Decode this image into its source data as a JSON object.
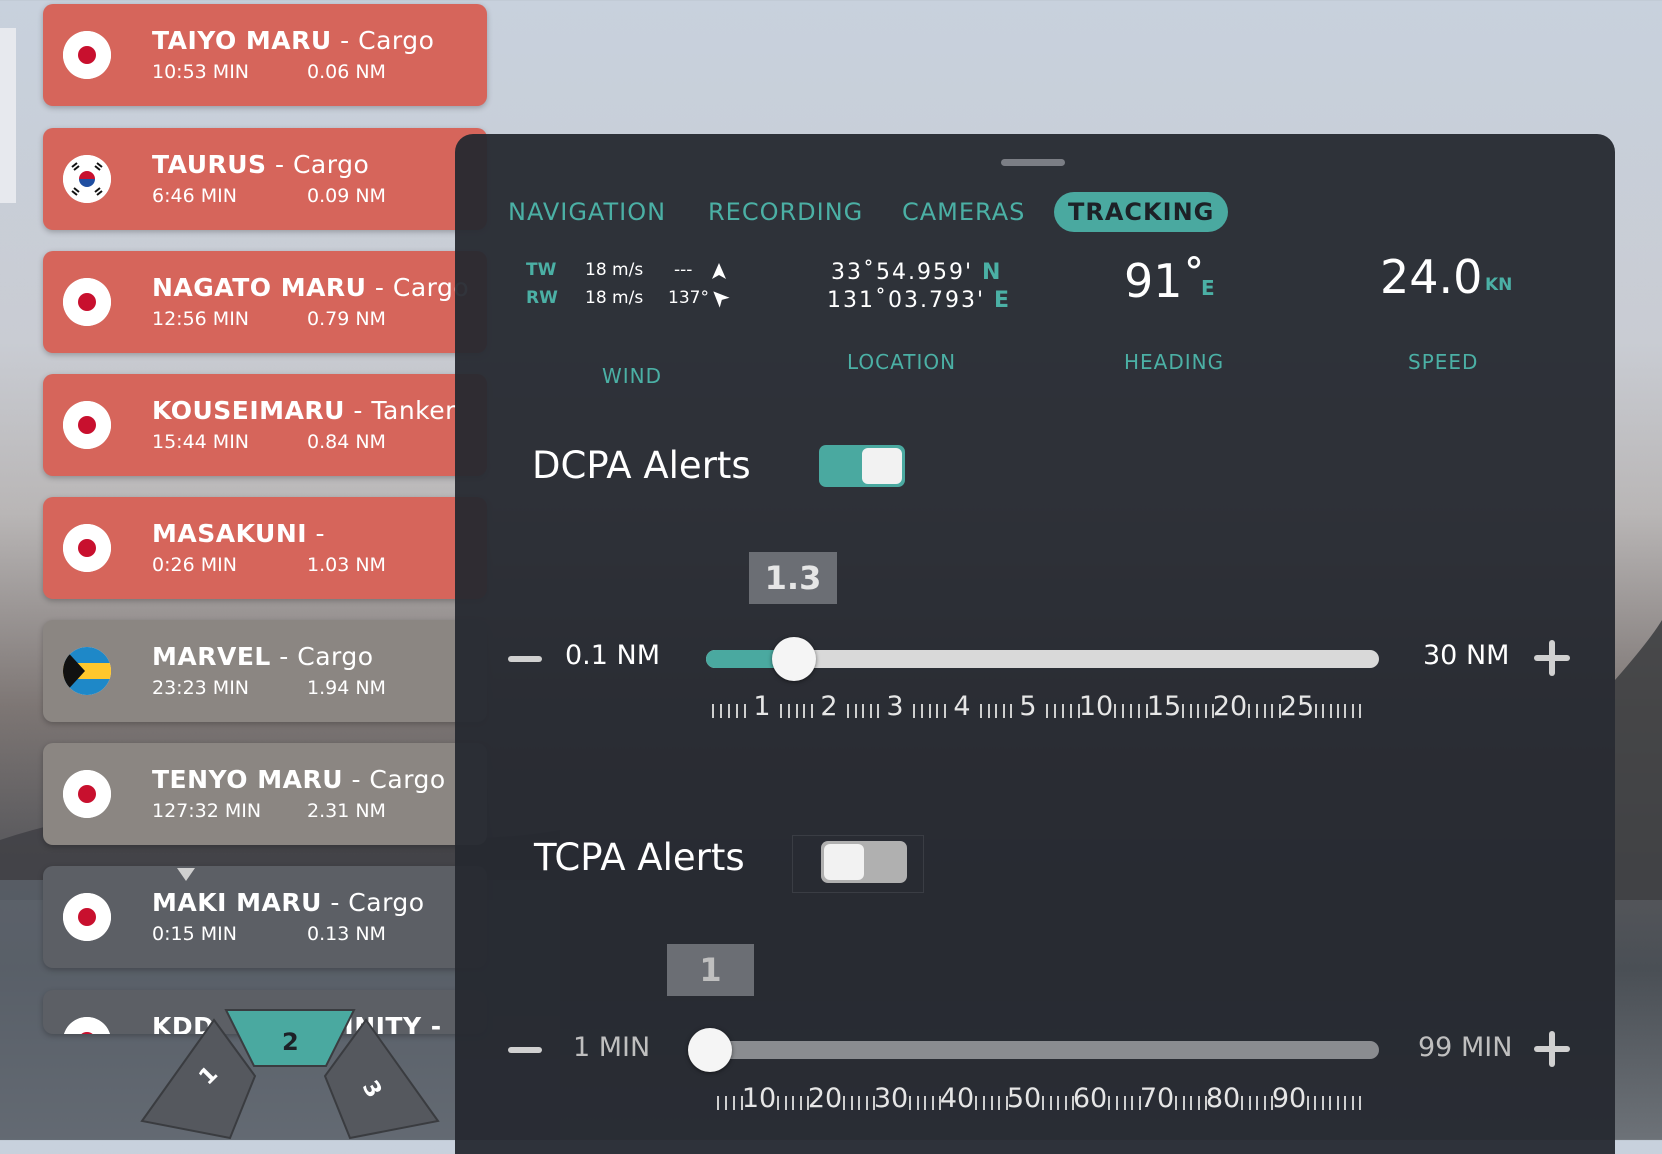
{
  "vessels": [
    {
      "name": "TAIYO MARU",
      "type": "Cargo",
      "time": "10:53 MIN",
      "dist": "0.06 NM",
      "flag": "japan",
      "status": "alert"
    },
    {
      "name": "TAURUS",
      "type": "Cargo",
      "time": "6:46 MIN",
      "dist": "0.09 NM",
      "flag": "south-korea",
      "status": "alert"
    },
    {
      "name": "NAGATO MARU",
      "type": "Cargo",
      "time": "12:56 MIN",
      "dist": "0.79 NM",
      "flag": "japan",
      "status": "alert"
    },
    {
      "name": "KOUSEIMARU",
      "type": "Tanker",
      "time": "15:44 MIN",
      "dist": "0.84 NM",
      "flag": "japan",
      "status": "alert"
    },
    {
      "name": "MASAKUNI",
      "type": "",
      "time": "0:26 MIN",
      "dist": "1.03 NM",
      "flag": "japan",
      "status": "alert"
    },
    {
      "name": "MARVEL",
      "type": "Cargo",
      "time": "23:23 MIN",
      "dist": "1.94 NM",
      "flag": "bahamas",
      "status": "normal"
    },
    {
      "name": "TENYO MARU",
      "type": "Cargo",
      "time": "127:32 MIN",
      "dist": "2.31 NM",
      "flag": "japan",
      "status": "normal"
    },
    {
      "name": "MAKI MARU",
      "type": "Cargo",
      "time": "0:15 MIN",
      "dist": "0.13 NM",
      "flag": "japan",
      "status": "dark"
    },
    {
      "name": "KDDI",
      "type": "",
      "time": "",
      "dist": "",
      "flag": "japan",
      "status": "dark",
      "partial": true
    }
  ],
  "partial_vessel_text": "KDD",
  "partial_vessel_text_right": "INITY -",
  "camera_selector": {
    "cam1": "1",
    "cam2": "2",
    "cam3": "3"
  },
  "tabs": [
    {
      "label": "NAVIGATION",
      "active": false
    },
    {
      "label": "RECORDING",
      "active": false
    },
    {
      "label": "CAMERAS",
      "active": false
    },
    {
      "label": "TRACKING",
      "active": true
    }
  ],
  "wind": {
    "tw_label": "TW",
    "rw_label": "RW",
    "tw_speed": "18 m/s",
    "rw_speed": "18 m/s",
    "tw_dir": "---",
    "rw_dir": "137°",
    "label": "WIND"
  },
  "location": {
    "lat": "33˚54.959'",
    "lat_hem": "N",
    "lon": "131˚03.793'",
    "lon_hem": "E",
    "label": "LOCATION"
  },
  "heading": {
    "value": "91˚",
    "unit": "E",
    "label": "HEADING"
  },
  "speed": {
    "value": "24.0",
    "unit": "KN",
    "label": "SPEED"
  },
  "dcpa": {
    "title": "DCPA Alerts",
    "enabled": true,
    "value": "1.3",
    "min_label": "0.1 NM",
    "max_label": "30 NM",
    "scale": [
      "1",
      "2",
      "3",
      "4",
      "5",
      "10",
      "15",
      "20",
      "25"
    ]
  },
  "tcpa": {
    "title": "TCPA Alerts",
    "enabled": false,
    "value": "1",
    "min_label": "1 MIN",
    "max_label": "99 MIN",
    "scale": [
      "10",
      "20",
      "30",
      "40",
      "50",
      "60",
      "70",
      "80",
      "90"
    ]
  },
  "colors": {
    "accent": "#4aa9a0",
    "alert": "#d6655b",
    "panel": "#262930"
  }
}
